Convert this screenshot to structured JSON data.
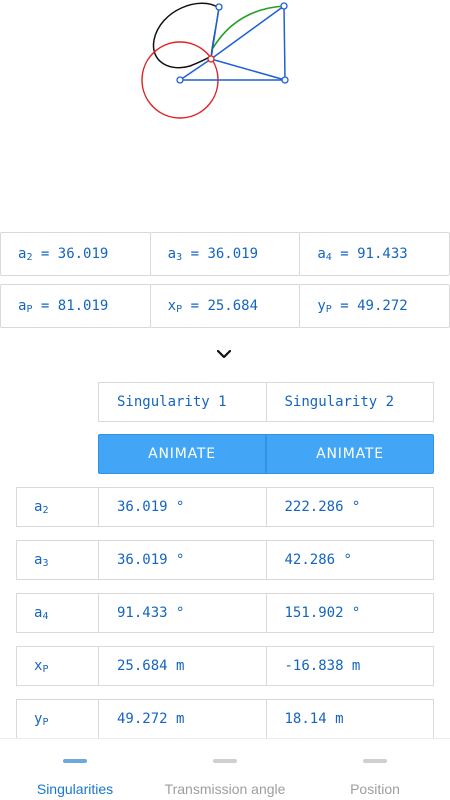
{
  "params": [
    [
      {
        "sym": "a",
        "sub": "2",
        "value": "36.019"
      },
      {
        "sym": "a",
        "sub": "3",
        "value": "36.019"
      },
      {
        "sym": "a",
        "sub": "4",
        "value": "91.433"
      }
    ],
    [
      {
        "sym": "a",
        "sub": "P",
        "value": "81.019"
      },
      {
        "sym": "x",
        "sub": "P",
        "value": "25.684"
      },
      {
        "sym": "y",
        "sub": "P",
        "value": "49.272"
      }
    ]
  ],
  "expand_icon": "chevron-down-icon",
  "singularities": {
    "headers": [
      "Singularity 1",
      "Singularity 2"
    ],
    "animate_labels": [
      "ANIMATE",
      "ANIMATE"
    ],
    "rows": [
      {
        "sym": "a",
        "sub": "2",
        "values": [
          "36.019 °",
          "222.286 °"
        ]
      },
      {
        "sym": "a",
        "sub": "3",
        "values": [
          "36.019 °",
          "42.286 °"
        ]
      },
      {
        "sym": "a",
        "sub": "4",
        "values": [
          "91.433 °",
          "151.902 °"
        ]
      },
      {
        "sym": "x",
        "sub": "P",
        "values": [
          "25.684 m",
          "-16.838 m"
        ]
      },
      {
        "sym": "y",
        "sub": "P",
        "values": [
          "49.272 m",
          "18.14 m"
        ]
      }
    ]
  },
  "nav": {
    "items": [
      "Singularities",
      "Transmission angle",
      "Position"
    ],
    "active": 0
  },
  "colors": {
    "accent": "#1565c0",
    "button": "#42a5f5",
    "nav_active": "#1976d2",
    "link_blue": "#1f5fd6",
    "circle_red": "#e02020",
    "arc_green": "#22a022",
    "curve_black": "#111111"
  }
}
